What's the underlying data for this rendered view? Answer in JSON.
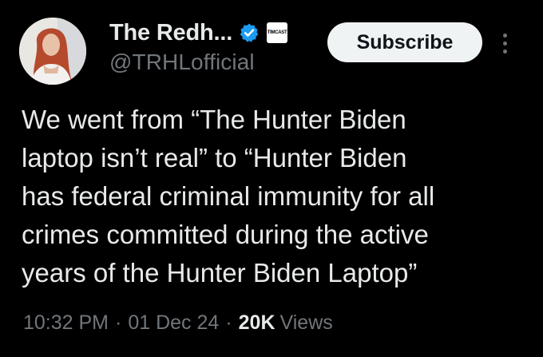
{
  "author": {
    "display_name": "The Redh...",
    "handle": "@TRHLofficial",
    "verified_icon": "verified-badge-icon",
    "affiliate_badge": {
      "text": "TIMCAST",
      "icon": "affiliate-badge-icon"
    }
  },
  "actions": {
    "subscribe_label": "Subscribe",
    "more_icon": "more-vertical-icon"
  },
  "tweet": {
    "text": "We went from “The Hunter Biden\nlaptop isn’t real” to “Hunter Biden\nhas federal criminal immunity for all\ncrimes committed during the active\nyears of the Hunter Biden Laptop”"
  },
  "meta": {
    "time": "10:32 PM",
    "separator": "·",
    "date": "01 Dec 24",
    "views_count": "20K",
    "views_label": "Views"
  },
  "colors": {
    "background": "#000000",
    "text_primary": "#e7e9ea",
    "text_secondary": "#71767b",
    "verified_blue": "#1d9bf0",
    "button_bg": "#eff3f4",
    "button_text": "#0f1419"
  }
}
